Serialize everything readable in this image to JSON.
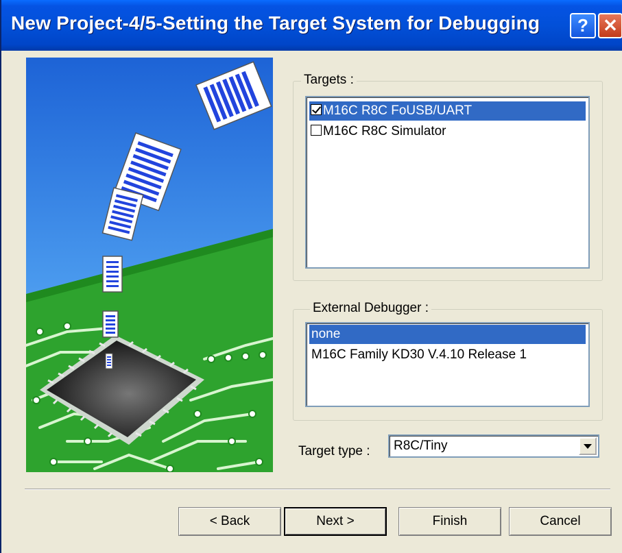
{
  "window": {
    "title": "New Project-4/5-Setting the Target System for Debugging",
    "help_label": "?",
    "close_label": "✕"
  },
  "targets": {
    "legend": "Targets :",
    "items": [
      {
        "label": "M16C R8C FoUSB/UART",
        "checked": true,
        "selected": true
      },
      {
        "label": "M16C R8C Simulator",
        "checked": false,
        "selected": false
      }
    ]
  },
  "external_debugger": {
    "legend": "External Debugger :",
    "items": [
      {
        "label": "none",
        "selected": true
      },
      {
        "label": "M16C Family KD30 V.4.10 Release 1",
        "selected": false
      }
    ]
  },
  "target_type": {
    "label": "Target type :",
    "value": "R8C/Tiny"
  },
  "buttons": {
    "back": "< Back",
    "next": "Next >",
    "finish": "Finish",
    "cancel": "Cancel"
  },
  "colors": {
    "titlebar": "#0250d8",
    "selection": "#316ac5",
    "dialog_bg": "#ece9d8",
    "pcb_green": "#2aa02a",
    "sky_blue": "#2a7be0"
  }
}
